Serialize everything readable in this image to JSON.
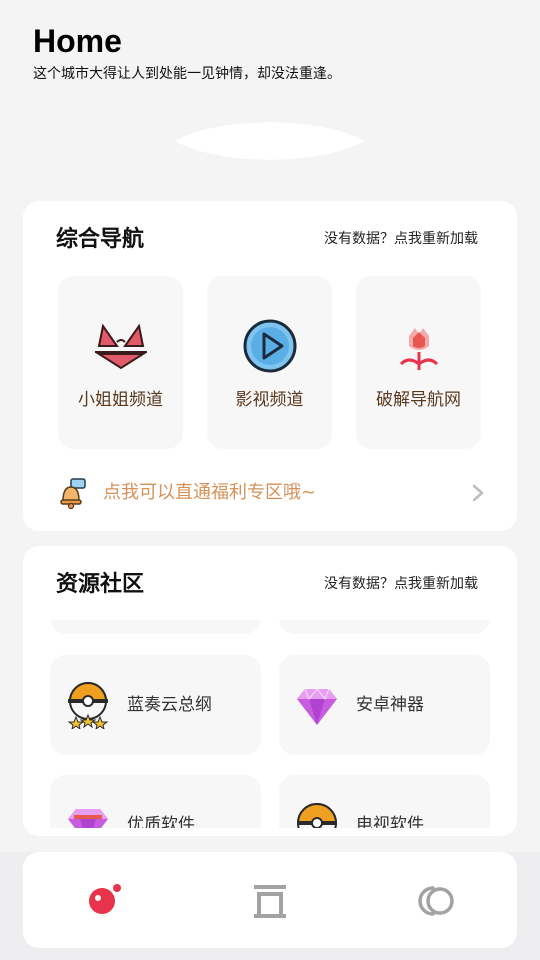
{
  "header": {
    "title": "Home",
    "subtitle": "这个城市大得让人到处能一见钟情，却没法重逢。"
  },
  "nav_section": {
    "title": "综合导航",
    "reload_text": "没有数据？点我重新加载",
    "tiles": [
      {
        "label": "小姐姐频道",
        "icon": "bikini-icon"
      },
      {
        "label": "影视频道",
        "icon": "play-icon"
      },
      {
        "label": "破解导航网",
        "icon": "flower-icon"
      }
    ],
    "promo": {
      "text": "点我可以直通福利专区哦~",
      "icon": "bell-icon"
    }
  },
  "resource_section": {
    "title": "资源社区",
    "reload_text": "没有数据？点我重新加载",
    "items": [
      {
        "label": "蓝奏云总纲",
        "icon": "pokeball-stars-icon"
      },
      {
        "label": "安卓神器",
        "icon": "diamond-icon"
      },
      {
        "label": "优质软件",
        "icon": "diamond-icon"
      },
      {
        "label": "电视软件",
        "icon": "pokeball-icon"
      }
    ]
  },
  "tabbar": {
    "tabs": [
      {
        "name": "home",
        "icon": "home-dot-icon",
        "active": true
      },
      {
        "name": "archive",
        "icon": "gate-icon",
        "active": false
      },
      {
        "name": "discover",
        "icon": "rings-icon",
        "active": false
      }
    ]
  },
  "colors": {
    "background": "#f4f4f5",
    "card": "#ffffff",
    "tile": "#f7f7f8",
    "accent_red": "#e8344a",
    "promo_text": "#d4925a",
    "tile_label": "#5a3a1e"
  }
}
